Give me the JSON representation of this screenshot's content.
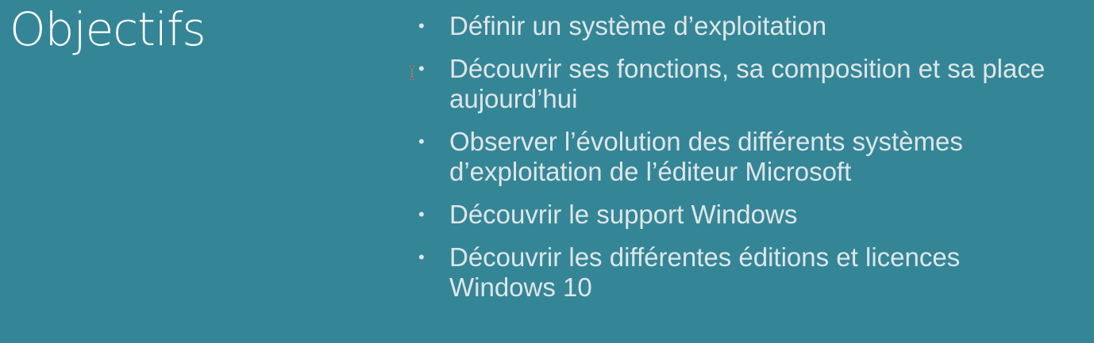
{
  "slide": {
    "title": "Objectifs",
    "bullets": [
      "Définir un système d’exploitation",
      "Découvrir ses fonctions, sa composition et sa place aujourd’hui",
      "Observer l’évolution des différents systèmes d’exploitation de l’éditeur Microsoft",
      "Découvrir le support Windows",
      "Découvrir les différentes éditions et licences Windows 10"
    ],
    "bullet_marker": "•",
    "cursor_icon": "text-cursor-icon"
  },
  "colors": {
    "background": "#348697",
    "title": "#ffffff",
    "body_text": "#dfe6e8"
  }
}
